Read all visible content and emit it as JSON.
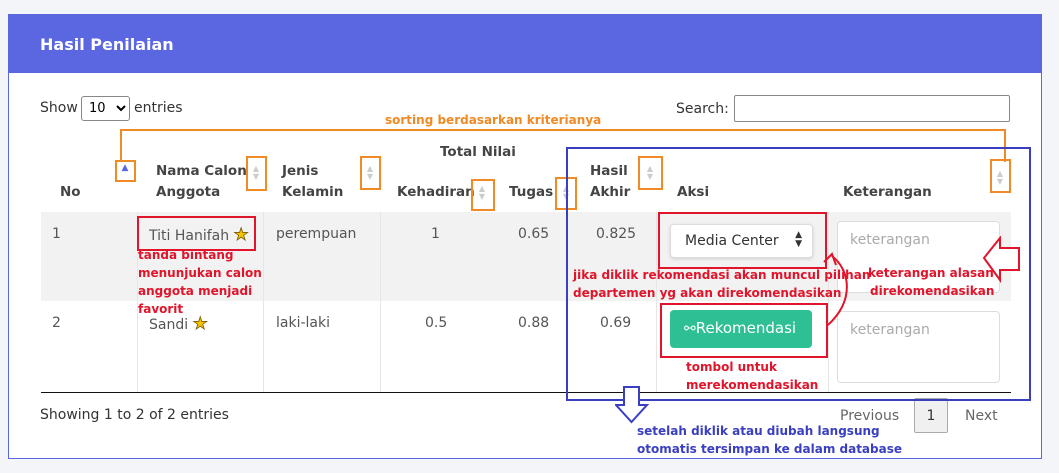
{
  "header": {
    "title": "Hasil Penilaian"
  },
  "length_control": {
    "show_label": "Show",
    "value": "10",
    "entries_label": "entries"
  },
  "search": {
    "label": "Search:",
    "value": ""
  },
  "table": {
    "group_header": "Total Nilai",
    "columns": {
      "no": "No",
      "nama_line1": "Nama Calon",
      "nama_line2": "Anggota",
      "jk_line1": "Jenis",
      "jk_line2": "Kelamin",
      "kehadiran": "Kehadiran",
      "tugas": "Tugas",
      "hasil_line1": "Hasil",
      "hasil_line2": "Akhir",
      "aksi": "Aksi",
      "keterangan": "Keterangan"
    },
    "rows": [
      {
        "no": "1",
        "nama": "Titi Hanifah",
        "jk": "perempuan",
        "kehadiran": "1",
        "tugas": "0.65",
        "hasil": "0.825",
        "aksi_select": "Media Center",
        "keterangan_placeholder": "keterangan"
      },
      {
        "no": "2",
        "nama": "Sandi",
        "jk": "laki-laki",
        "kehadiran": "0.5",
        "tugas": "0.88",
        "hasil": "0.69",
        "aksi_button": "Rekomendasi",
        "keterangan_placeholder": "keterangan"
      }
    ]
  },
  "footer": {
    "info": "Showing 1 to 2 of 2 entries",
    "previous": "Previous",
    "page": "1",
    "next": "Next"
  },
  "annotations": {
    "sorting": "sorting berdasarkan kriterianya",
    "star_note": [
      "tanda bintang",
      "menunjukan calon",
      "anggota menjadi",
      "favorit"
    ],
    "dropdown_note": [
      "jika diklik rekomendasi akan muncul pilihan",
      "departemen yg akan direkomendasikan"
    ],
    "keterangan_note": [
      "keterangan alasan",
      "direkomendasikan"
    ],
    "button_note": [
      "tombol untuk",
      "merekomendasikan"
    ],
    "save_note": [
      "setelah diklik atau diubah langsung",
      "otomatis tersimpan ke dalam database"
    ]
  },
  "colors": {
    "header_bg": "#5b67e1",
    "button_green": "#2fbf94",
    "annotation_red": "#e0142a",
    "annotation_orange": "#f08a24",
    "annotation_blue": "#3a3fc2",
    "star": "#f5c400"
  }
}
